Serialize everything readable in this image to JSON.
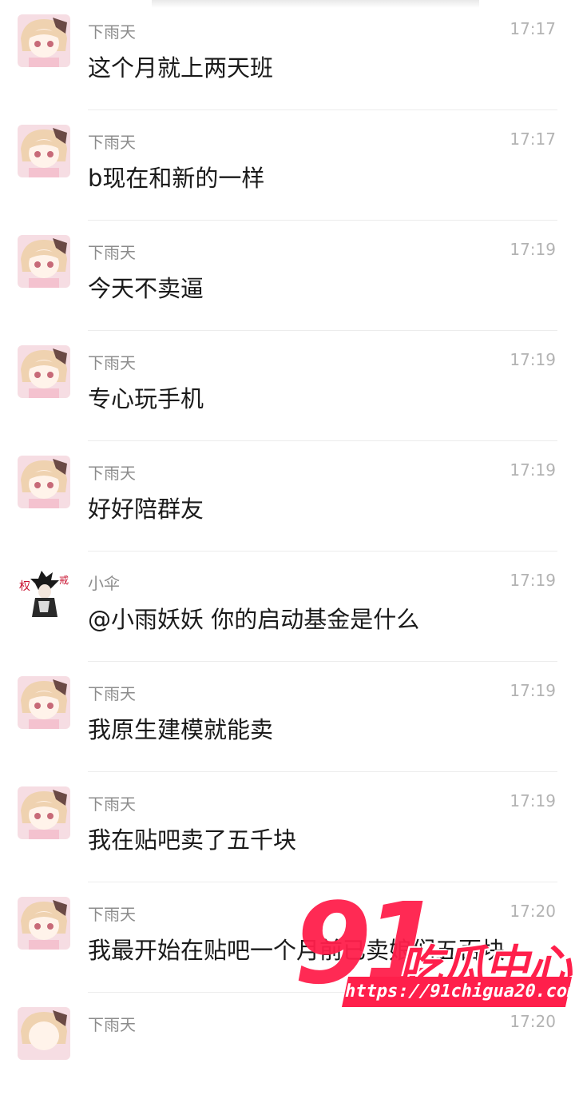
{
  "messages": [
    {
      "sender": "下雨天",
      "time": "17:17",
      "text": "这个月就上两天班",
      "avatar": "anime-girl-avatar"
    },
    {
      "sender": "下雨天",
      "time": "17:17",
      "text": "b现在和新的一样",
      "avatar": "anime-girl-avatar"
    },
    {
      "sender": "下雨天",
      "time": "17:19",
      "text": "今天不卖逼",
      "avatar": "anime-girl-avatar"
    },
    {
      "sender": "下雨天",
      "time": "17:19",
      "text": "专心玩手机",
      "avatar": "anime-girl-avatar"
    },
    {
      "sender": "下雨天",
      "time": "17:19",
      "text": "好好陪群友",
      "avatar": "anime-girl-avatar"
    },
    {
      "sender": "小伞",
      "time": "17:19",
      "text": "@小雨妖妖 你的启动基金是什么",
      "avatar": "ink-character-avatar"
    },
    {
      "sender": "下雨天",
      "time": "17:19",
      "text": "我原生建模就能卖",
      "avatar": "anime-girl-avatar"
    },
    {
      "sender": "下雨天",
      "time": "17:19",
      "text": "我在贴吧卖了五千块",
      "avatar": "anime-girl-avatar"
    },
    {
      "sender": "下雨天",
      "time": "17:20",
      "text": "我最开始在贴吧一个月前已卖娘们五百块",
      "avatar": "anime-girl-avatar"
    },
    {
      "sender": "下雨天",
      "time": "17:20",
      "text": "",
      "avatar": "anime-girl-avatar"
    }
  ],
  "watermark": {
    "number": "91",
    "brand": "吃瓜中心",
    "url": "https://91chigua20.com"
  },
  "colors": {
    "watermark": "#ff1f4b",
    "name": "#8c8c8c",
    "time": "#b3b3b3"
  }
}
